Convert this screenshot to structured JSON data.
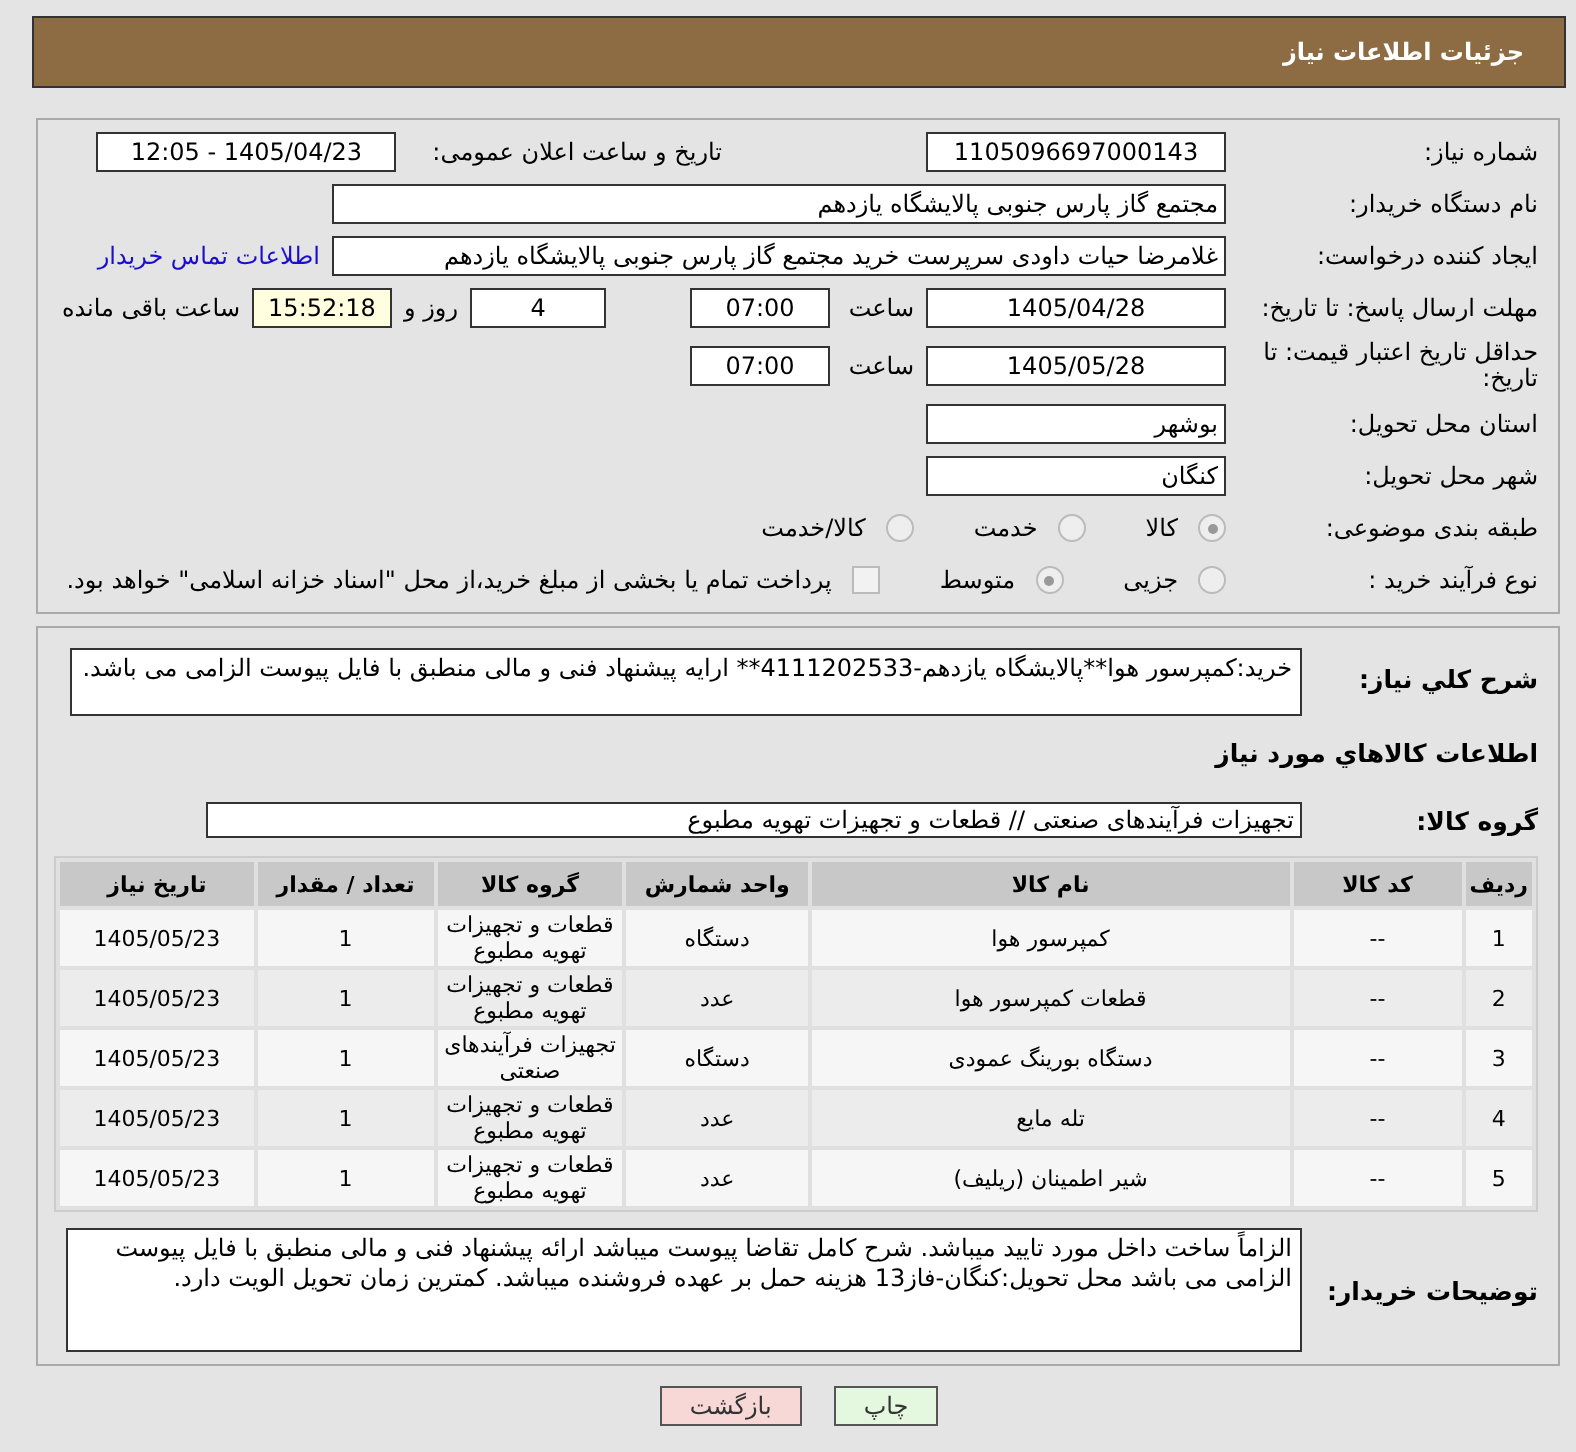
{
  "header": {
    "title": "جزئیات اطلاعات نیاز"
  },
  "need_number": {
    "label": "شماره نیاز:",
    "value": "1105096697000143"
  },
  "announce": {
    "label": "تاریخ و ساعت اعلان عمومی:",
    "value": "1405/04/23 - 12:05"
  },
  "buyer_org": {
    "label": "نام دستگاه خریدار:",
    "value": "مجتمع گاز پارس جنوبی  پالایشگاه یازدهم"
  },
  "requester": {
    "label": "ایجاد کننده درخواست:",
    "value": "غلامرضا حیات داودی سرپرست خرید مجتمع گاز پارس جنوبی  پالایشگاه یازدهم",
    "link": "اطلاعات تماس خریدار"
  },
  "deadline": {
    "label": "مهلت ارسال پاسخ: تا تاریخ:",
    "date": "1405/04/28",
    "time_label": "ساعت",
    "time": "07:00",
    "days": "4",
    "days_label": "روز و",
    "remaining": "15:52:18",
    "remaining_label": "ساعت باقی مانده"
  },
  "validity": {
    "label": "حداقل تاریخ اعتبار قیمت: تا تاریخ:",
    "date": "1405/05/28",
    "time_label": "ساعت",
    "time": "07:00"
  },
  "province": {
    "label": "استان محل تحویل:",
    "value": "بوشهر"
  },
  "city": {
    "label": "شهر محل تحویل:",
    "value": "کنگان"
  },
  "category": {
    "label": "طبقه بندی موضوعی:",
    "options": [
      {
        "label": "کالا",
        "selected": true
      },
      {
        "label": "خدمت",
        "selected": false
      },
      {
        "label": "کالا/خدمت",
        "selected": false
      }
    ]
  },
  "process": {
    "label": "نوع فرآیند خرید :",
    "options": [
      {
        "label": "جزیی",
        "selected": false
      },
      {
        "label": "متوسط",
        "selected": true
      }
    ],
    "payment": {
      "label": "پرداخت تمام یا بخشی از مبلغ خرید،از محل \"اسناد خزانه اسلامی\" خواهد بود.",
      "checked": false
    }
  },
  "description": {
    "label": "شرح کلي نياز:",
    "value": "خرید:کمپرسور هوا**پالایشگاه یازدهم-4111202533** ارایه پیشنهاد فنی و مالی منطبق با فایل پیوست الزامی می باشد."
  },
  "goods_heading": "اطلاعات کالاهاي مورد نياز",
  "goods_group": {
    "label": "گروه کالا:",
    "value": "تجهیزات فرآیندهای صنعتی //  قطعات و تجهیزات تهویه مطبوع"
  },
  "table": {
    "columns": [
      "ردیف",
      "کد کالا",
      "نام کالا",
      "واحد شمارش",
      "گروه کالا",
      "تعداد / مقدار",
      "تاریخ نیاز"
    ],
    "rows": [
      [
        "1",
        "--",
        "کمپرسور هوا",
        "دستگاه",
        "قطعات و تجهیزات تهویه مطبوع",
        "1",
        "1405/05/23"
      ],
      [
        "2",
        "--",
        "قطعات کمپرسور هوا",
        "عدد",
        "قطعات و تجهیزات تهویه مطبوع",
        "1",
        "1405/05/23"
      ],
      [
        "3",
        "--",
        "دستگاه بورینگ عمودی",
        "دستگاه",
        "تجهیزات فرآیندهای صنعتی",
        "1",
        "1405/05/23"
      ],
      [
        "4",
        "--",
        "تله مایع",
        "عدد",
        "قطعات و تجهیزات تهویه مطبوع",
        "1",
        "1405/05/23"
      ],
      [
        "5",
        "--",
        "شیر اطمینان (ریلیف)",
        "عدد",
        "قطعات و تجهیزات تهویه مطبوع",
        "1",
        "1405/05/23"
      ]
    ]
  },
  "buyer_notes": {
    "label": "توضیحات خریدار:",
    "value": "الزاماً ساخت داخل مورد تایید میباشد. شرح کامل تقاضا پیوست میباشد ارائه پیشنهاد فنی و مالی منطبق با فایل پیوست الزامی می باشد محل تحویل:کنگان-فاز13 هزینه حمل بر عهده فروشنده میباشد. کمترین زمان تحویل الویت دارد."
  },
  "buttons": [
    {
      "label": "چاپ",
      "kind": "print"
    },
    {
      "label": "بازگشت",
      "kind": "back"
    }
  ]
}
